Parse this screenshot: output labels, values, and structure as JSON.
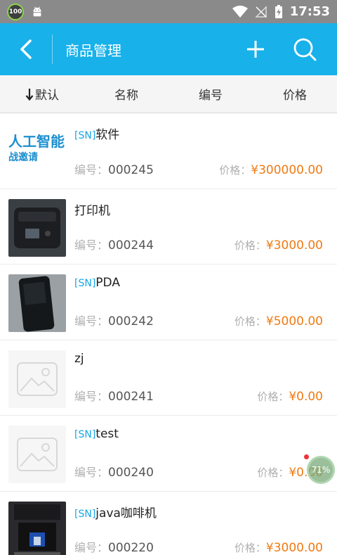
{
  "statusbar": {
    "battery_badge": "100",
    "time": "17:53"
  },
  "appbar": {
    "title": "商品管理"
  },
  "sortbar": {
    "default_label": "默认",
    "name_label": "名称",
    "code_label": "编号",
    "price_label": "价格"
  },
  "labels": {
    "code_prefix": "编号：",
    "price_prefix": "价格：",
    "sn_tag": "[SN]"
  },
  "products": [
    {
      "sn": "[SN]",
      "name": "软件",
      "code": "000245",
      "price": "¥300000.00",
      "image": "ai-banner"
    },
    {
      "sn": "",
      "name": "打印机",
      "code": "000244",
      "price": "¥3000.00",
      "image": "printer"
    },
    {
      "sn": "[SN]",
      "name": "PDA",
      "code": "000242",
      "price": "¥5000.00",
      "image": "pda"
    },
    {
      "sn": "",
      "name": "zj",
      "code": "000241",
      "price": "¥0.00",
      "image": "placeholder"
    },
    {
      "sn": "[SN]",
      "name": "test",
      "code": "000240",
      "price": "¥0.00",
      "image": "placeholder"
    },
    {
      "sn": "[SN]",
      "name": "java咖啡机",
      "code": "000220",
      "price": "¥3000.00",
      "image": "coffee-machine"
    }
  ],
  "thumb_texts": {
    "ai_line1": "人工智能",
    "ai_line2": "战邀请"
  },
  "float_badge": "71%",
  "colors": {
    "appbar": "#18b1ea",
    "sn_tag": "#18a6e3",
    "price": "#f07a12"
  }
}
